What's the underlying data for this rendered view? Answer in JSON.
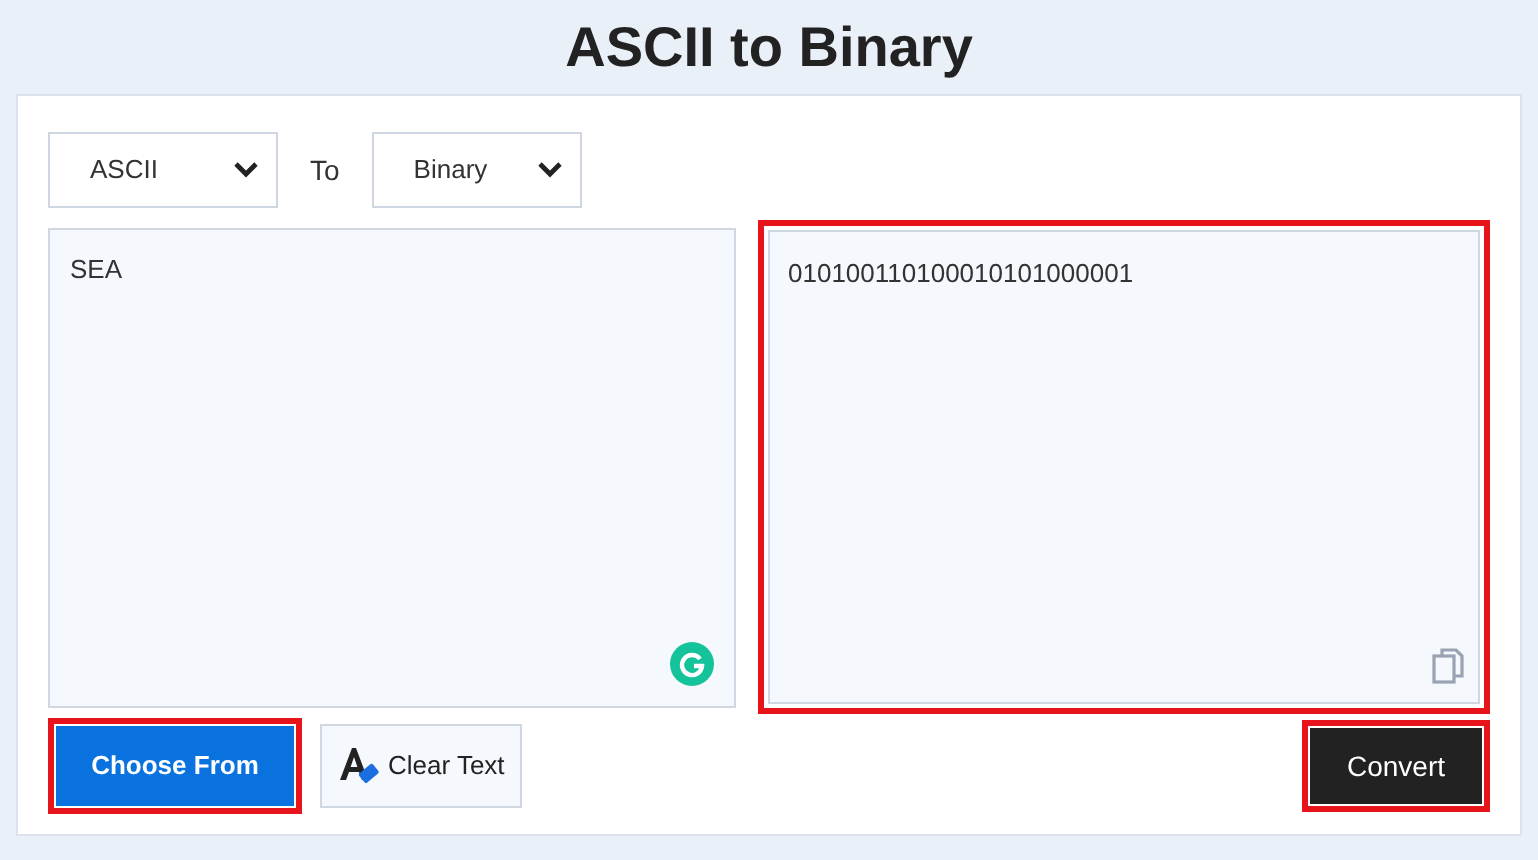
{
  "title": "ASCII to Binary",
  "from_select": {
    "value": "ASCII"
  },
  "to_label": "To",
  "to_select": {
    "value": "Binary"
  },
  "input": {
    "value": "SEA",
    "highlighted": false
  },
  "output": {
    "value": "010100110100010101000001",
    "highlighted": true
  },
  "buttons": [
    {
      "kind": "primary",
      "label": "Choose From",
      "highlighted": true
    },
    {
      "kind": "clear",
      "label": "Clear Text",
      "highlighted": false
    },
    {
      "kind": "convert",
      "label": "Convert",
      "highlighted": true
    }
  ]
}
